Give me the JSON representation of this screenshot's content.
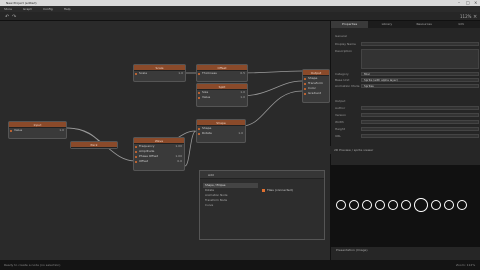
{
  "window": {
    "title": "New Project (edited)"
  },
  "menu": [
    "Store",
    "Graph",
    "Config",
    "Help"
  ],
  "toolbar": {
    "undo": "↶",
    "redo": "↷",
    "zoom": "112%",
    "close": "×"
  },
  "nodes": {
    "noise": {
      "title": "Noise",
      "rows": [
        {
          "label": "Value",
          "value": "1.0"
        }
      ]
    },
    "scale_top": {
      "title": "Scale",
      "rows": [
        {
          "label": "Scale",
          "value": "1.0"
        }
      ]
    },
    "offset": {
      "title": "Offset",
      "rows": [
        {
          "label": "Thickness",
          "value": "0.5"
        }
      ]
    },
    "split": {
      "title": "Split",
      "rows": [
        {
          "label": "Size",
          "value": "1.0"
        },
        {
          "label": "Value",
          "value": "1.0"
        }
      ]
    },
    "ellipse": {
      "title": "Shape",
      "rows": [
        {
          "label": "Shape",
          "value": ""
        },
        {
          "label": "Rotate",
          "value": "1.0"
        }
      ]
    },
    "output": {
      "title": "Output",
      "rows": [
        {
          "label": "Shape",
          "value": ""
        },
        {
          "label": "Transform",
          "value": ""
        },
        {
          "label": "Color",
          "value": ""
        },
        {
          "label": "Gradient",
          "value": ""
        }
      ]
    },
    "input": {
      "title": "Input",
      "rows": [
        {
          "label": "Value",
          "value": "1.0"
        }
      ]
    },
    "small": {
      "title": "Pack",
      "rows": []
    },
    "wave": {
      "title": "Wave",
      "rows": [
        {
          "label": "Frequency",
          "value": "1.00"
        },
        {
          "label": "Amplitude",
          "value": ""
        },
        {
          "label": "Phase Offset",
          "value": "1.00"
        },
        {
          "label": "Offset",
          "value": "0.0"
        }
      ]
    }
  },
  "panel": {
    "tabs": [
      "Properties",
      "Library",
      "Resources",
      "Info"
    ],
    "section_general": "General",
    "props": [
      "Display Name",
      "Description"
    ],
    "dropdowns": [
      {
        "label": "Category",
        "value": "Misc"
      },
      {
        "label": "Base Unit",
        "value": "Sprite (with alpha layer)"
      },
      {
        "label": "Animation Mode",
        "value": "Sprites"
      }
    ],
    "section_output": "Output",
    "out_props": [
      "Author",
      "Version",
      "Width",
      "Height",
      "URL"
    ]
  },
  "viewport": {
    "title": "2D Preview / sprite viewer",
    "bottom": "Presentation (Image)"
  },
  "dialog": {
    "title": "Add",
    "list": [
      "Shape / Ellipse",
      "Rotate",
      "Animation Node",
      "Transform Node",
      "Curve"
    ],
    "check_label": "Tiles (connected)"
  },
  "status": {
    "left": "Ready to create a node (no selection)",
    "right": "Zoom: 112%"
  }
}
